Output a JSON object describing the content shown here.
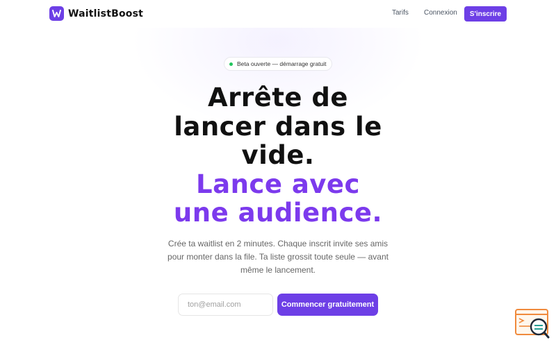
{
  "brand": {
    "name": "WaitlistBoost",
    "logo_letter": "W"
  },
  "nav": {
    "links": [
      "Tarifs",
      "Connexion"
    ],
    "cta": "S'inscrire"
  },
  "badge": {
    "text": "Beta ouverte — démarrage gratuit"
  },
  "hero": {
    "headline_dark": [
      "Arrête de",
      "lancer dans le",
      "vide."
    ],
    "headline_accent": [
      "Lance avec",
      "une audience."
    ],
    "subtitle": [
      "Crée ta waitlist en 2 minutes. Chaque inscrit invite ses amis",
      "pour monter dans la file. Ta liste grossit toute seule — avant",
      "même le lancement."
    ],
    "email_placeholder": "ton@email.com",
    "cta": "Commencer gratuitement"
  },
  "colors": {
    "accent": "#6d3fe6",
    "headline_accent": "#7c3aed",
    "status_dot": "#22c55e"
  },
  "widget": {
    "icon": "support-search-icon"
  }
}
